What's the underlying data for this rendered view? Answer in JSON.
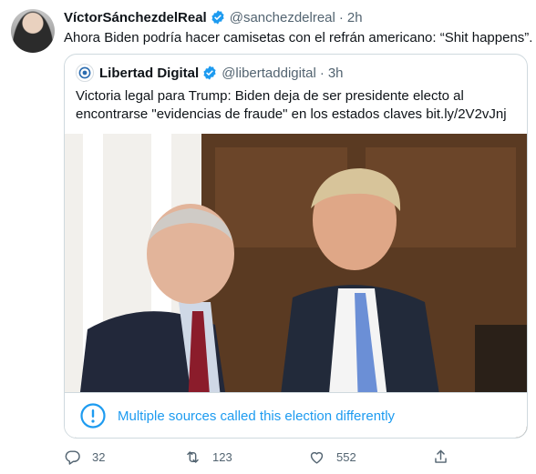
{
  "tweet": {
    "author_name": "VíctorSánchezdelReal",
    "author_handle": "@sanchezdelreal",
    "separator": "·",
    "time": "2h",
    "text": "Ahora Biden podría hacer camisetas con el refrán americano: “Shit happens”."
  },
  "quote": {
    "author_name": "Libertad Digital",
    "author_handle": "@libertaddigital",
    "separator": "·",
    "time": "3h",
    "text": "Victoria legal para Trump: Biden deja de ser presidente electo al encontrarse \"evidencias de fraude\" en los estados claves bit.ly/2V2vJnj",
    "notice": "Multiple sources called this election differently"
  },
  "actions": {
    "replies": "32",
    "retweets": "123",
    "likes": "552"
  },
  "colors": {
    "accent": "#1d9bf0",
    "secondary_text": "#536471",
    "border": "#cfd9de"
  },
  "icons": {
    "verified": "verified-badge-icon",
    "reply": "reply-icon",
    "retweet": "retweet-icon",
    "like": "heart-icon",
    "share": "share-icon",
    "notice": "info-icon"
  }
}
